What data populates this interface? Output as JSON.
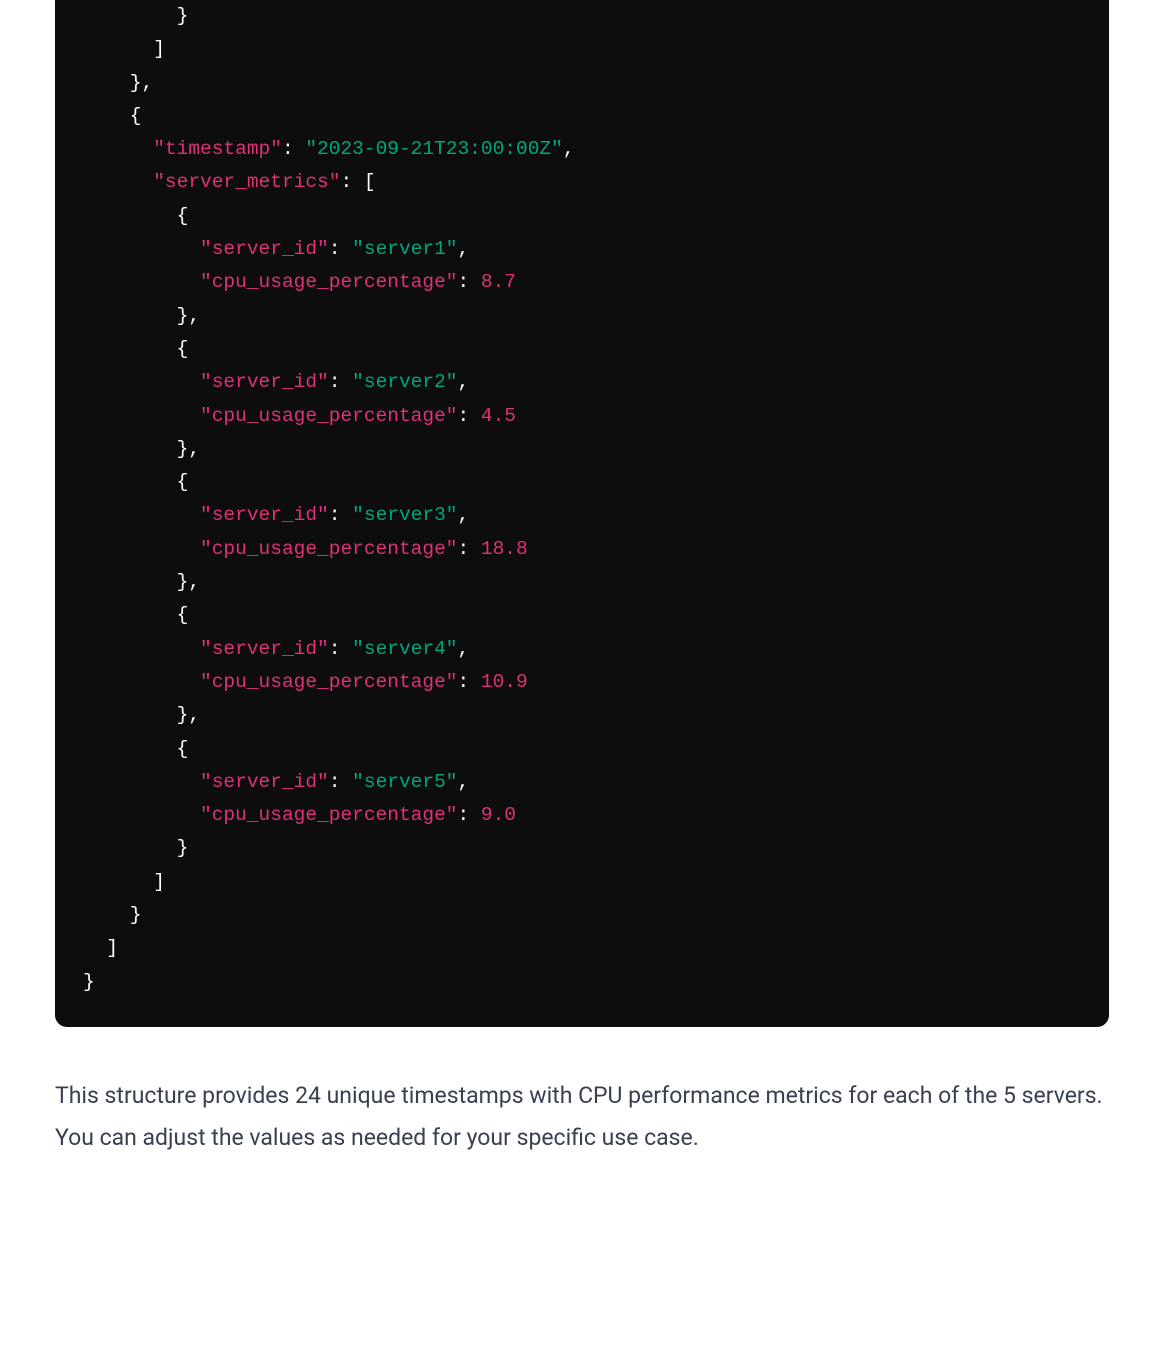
{
  "code": {
    "lines": [
      [
        [
          "p",
          "        }"
        ]
      ],
      [
        [
          "p",
          "      ]"
        ]
      ],
      [
        [
          "p",
          "    },"
        ]
      ],
      [
        [
          "p",
          "    {"
        ]
      ],
      [
        [
          "p",
          "      "
        ],
        [
          "k",
          "\"timestamp\""
        ],
        [
          "p",
          ": "
        ],
        [
          "s",
          "\"2023-09-21T23:00:00Z\""
        ],
        [
          "p",
          ","
        ]
      ],
      [
        [
          "p",
          "      "
        ],
        [
          "k",
          "\"server_metrics\""
        ],
        [
          "p",
          ": ["
        ]
      ],
      [
        [
          "p",
          "        {"
        ]
      ],
      [
        [
          "p",
          "          "
        ],
        [
          "k",
          "\"server_id\""
        ],
        [
          "p",
          ": "
        ],
        [
          "s",
          "\"server1\""
        ],
        [
          "p",
          ","
        ]
      ],
      [
        [
          "p",
          "          "
        ],
        [
          "k",
          "\"cpu_usage_percentage\""
        ],
        [
          "p",
          ": "
        ],
        [
          "n",
          "8.7"
        ]
      ],
      [
        [
          "p",
          "        },"
        ]
      ],
      [
        [
          "p",
          "        {"
        ]
      ],
      [
        [
          "p",
          "          "
        ],
        [
          "k",
          "\"server_id\""
        ],
        [
          "p",
          ": "
        ],
        [
          "s",
          "\"server2\""
        ],
        [
          "p",
          ","
        ]
      ],
      [
        [
          "p",
          "          "
        ],
        [
          "k",
          "\"cpu_usage_percentage\""
        ],
        [
          "p",
          ": "
        ],
        [
          "n",
          "4.5"
        ]
      ],
      [
        [
          "p",
          "        },"
        ]
      ],
      [
        [
          "p",
          "        {"
        ]
      ],
      [
        [
          "p",
          "          "
        ],
        [
          "k",
          "\"server_id\""
        ],
        [
          "p",
          ": "
        ],
        [
          "s",
          "\"server3\""
        ],
        [
          "p",
          ","
        ]
      ],
      [
        [
          "p",
          "          "
        ],
        [
          "k",
          "\"cpu_usage_percentage\""
        ],
        [
          "p",
          ": "
        ],
        [
          "n",
          "18.8"
        ]
      ],
      [
        [
          "p",
          "        },"
        ]
      ],
      [
        [
          "p",
          "        {"
        ]
      ],
      [
        [
          "p",
          "          "
        ],
        [
          "k",
          "\"server_id\""
        ],
        [
          "p",
          ": "
        ],
        [
          "s",
          "\"server4\""
        ],
        [
          "p",
          ","
        ]
      ],
      [
        [
          "p",
          "          "
        ],
        [
          "k",
          "\"cpu_usage_percentage\""
        ],
        [
          "p",
          ": "
        ],
        [
          "n",
          "10.9"
        ]
      ],
      [
        [
          "p",
          "        },"
        ]
      ],
      [
        [
          "p",
          "        {"
        ]
      ],
      [
        [
          "p",
          "          "
        ],
        [
          "k",
          "\"server_id\""
        ],
        [
          "p",
          ": "
        ],
        [
          "s",
          "\"server5\""
        ],
        [
          "p",
          ","
        ]
      ],
      [
        [
          "p",
          "          "
        ],
        [
          "k",
          "\"cpu_usage_percentage\""
        ],
        [
          "p",
          ": "
        ],
        [
          "n",
          "9.0"
        ]
      ],
      [
        [
          "p",
          "        }"
        ]
      ],
      [
        [
          "p",
          "      ]"
        ]
      ],
      [
        [
          "p",
          "    }"
        ]
      ],
      [
        [
          "p",
          "  ]"
        ]
      ],
      [
        [
          "p",
          "}"
        ]
      ]
    ]
  },
  "explain_text": "This structure provides 24 unique timestamps with CPU performance metrics for each of the 5 servers. You can adjust the values as needed for your specific use case."
}
